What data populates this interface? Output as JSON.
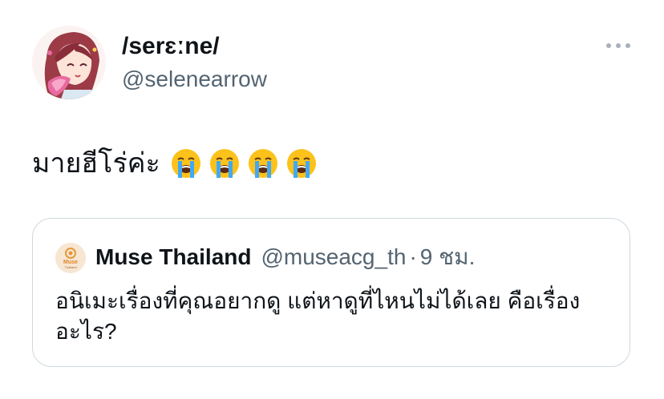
{
  "tweet": {
    "author": {
      "display_name": "/serɛːne/",
      "handle": "@selenearrow"
    },
    "text": "มายฮีโร่ค่ะ",
    "emojis": [
      "loudly-crying-face",
      "loudly-crying-face",
      "loudly-crying-face",
      "loudly-crying-face"
    ],
    "more_icon": "more-horizontal-icon"
  },
  "quote": {
    "author": {
      "display_name": "Muse Thailand",
      "handle": "@museacg_th",
      "time": "9 ชม.",
      "separator": "·",
      "avatar_label_top": "Muse",
      "avatar_label_bottom": "Thailand"
    },
    "text": "อนิเมะเรื่องที่คุณอยากดู แต่หาดูที่ไหนไม่ได้เลย คือเรื่องอะไร?"
  },
  "colors": {
    "text": "#0f1419",
    "secondary": "#536471",
    "border": "#cfd9de",
    "emoji_face": "#fcc21b",
    "tears": "#40a9f5"
  }
}
